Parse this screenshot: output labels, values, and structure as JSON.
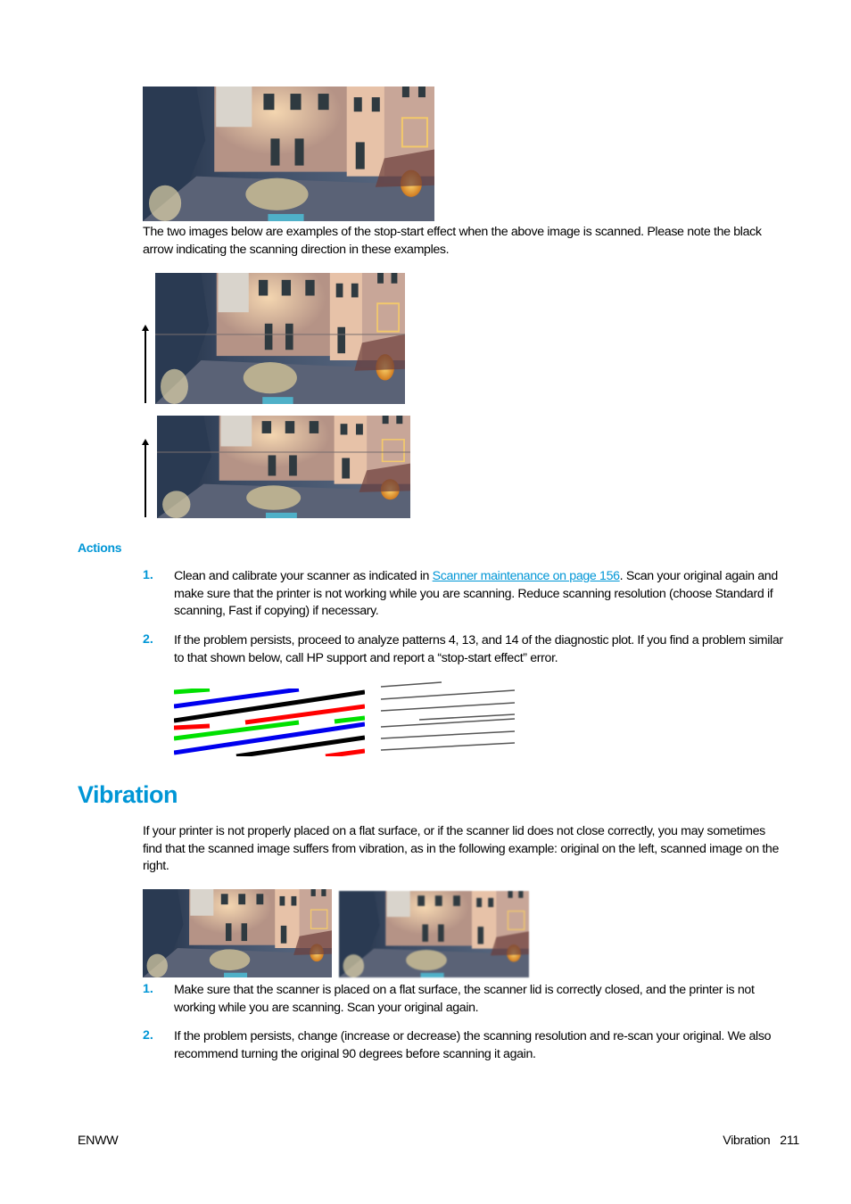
{
  "intro": {
    "paragraph": "The two images below are examples of the stop-start effect when the above image is scanned. Please note the black arrow indicating the scanning direction in these examples."
  },
  "images": {
    "original_alt": "Original image: coastal village buildings at dusk",
    "scan1_alt": "Scanned example 1 with stop-start effect",
    "scan2_alt": "Scanned example 2 with stop-start effect",
    "diagnostic_color_alt": "Diagnostic plot colored lines pattern with stop-start effect",
    "diagnostic_gray_alt": "Diagnostic plot gray lines pattern with stop-start effect",
    "vibration_original_alt": "Original image",
    "vibration_scanned_alt": "Scanned image with vibration"
  },
  "actions": {
    "heading": "Actions",
    "items": [
      {
        "number": "1.",
        "text_before": "Clean and calibrate your scanner as indicated in ",
        "link": "Scanner maintenance on page 156",
        "text_after": ". Scan your original again and make sure that the printer is not working while you are scanning. Reduce scanning resolution (choose Standard if scanning, Fast if copying) if necessary."
      },
      {
        "number": "2.",
        "text": "If the problem persists, proceed to analyze patterns 4, 13, and 14 of the diagnostic plot. If you find a problem similar to that shown below, call HP support and report a “stop-start effect” error."
      }
    ]
  },
  "vibration": {
    "heading": "Vibration",
    "paragraph": "If your printer is not properly placed on a flat surface, or if the scanner lid does not close correctly, you may sometimes find that the scanned image suffers from vibration, as in the following example: original on the left, scanned image on the right.",
    "items": [
      {
        "number": "1.",
        "text": "Make sure that the scanner is placed on a flat surface, the scanner lid is correctly closed, and the printer is not working while you are scanning. Scan your original again."
      },
      {
        "number": "2.",
        "text": "If the problem persists, change (increase or decrease) the scanning resolution and re-scan your original. We also recommend turning the original 90 degrees before scanning it again."
      }
    ]
  },
  "footer": {
    "left": "ENWW",
    "section": "Vibration",
    "page": "211"
  },
  "colors": {
    "accent": "#0096d6"
  }
}
